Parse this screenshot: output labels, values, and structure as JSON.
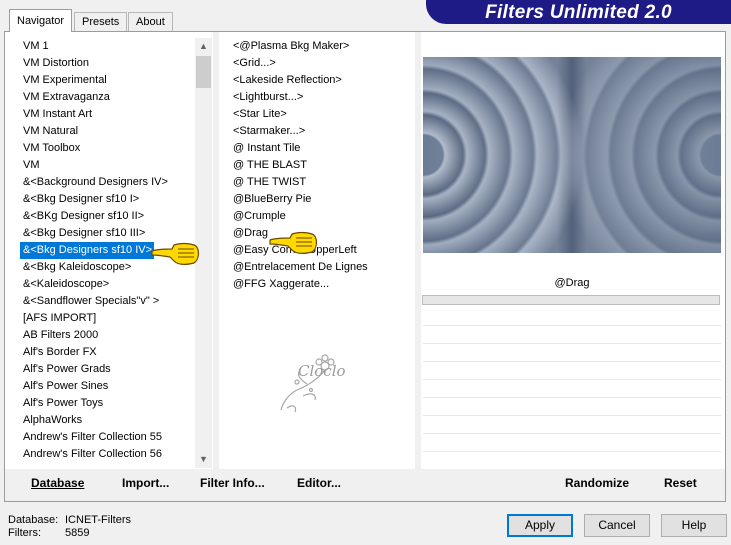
{
  "tabs": [
    "Navigator",
    "Presets",
    "About"
  ],
  "active_tab": "Navigator",
  "banner": "Filters Unlimited 2.0",
  "categories": [
    "VM 1",
    "VM Distortion",
    "VM Experimental",
    "VM Extravaganza",
    "VM Instant Art",
    "VM Natural",
    "VM Toolbox",
    "VM",
    "&<Background Designers IV>",
    "&<Bkg Designer sf10 I>",
    "&<BKg Designer sf10 II>",
    "&<Bkg Designer sf10 III>",
    "&<Bkg Designers sf10 IV>",
    "&<Bkg Kaleidoscope>",
    "&<Kaleidoscope>",
    "&<Sandflower Specials\"v\" >",
    "[AFS IMPORT]",
    "AB Filters 2000",
    "Alf's Border FX",
    "Alf's Power Grads",
    "Alf's Power Sines",
    "Alf's Power Toys",
    "AlphaWorks",
    "Andrew's Filter Collection 55",
    "Andrew's Filter Collection 56"
  ],
  "selected_category": "&<Bkg Designers sf10 IV>",
  "filters": [
    "<@Plasma Bkg Maker>",
    "<Grid...>",
    "<Lakeside Reflection>",
    "<Lightburst...>",
    "<Star Lite>",
    "<Starmaker...>",
    "@ Instant Tile",
    "@ THE BLAST",
    "@ THE TWIST",
    "@BlueBerry Pie",
    "@Crumple",
    "@Drag",
    "@Easy Corner UpperLeft",
    "@Entrelacement De Lignes",
    "@FFG Xaggerate..."
  ],
  "preview": {
    "filter_name": "@Drag",
    "watermark": "Cloclo"
  },
  "toolbar": {
    "database": "Database",
    "import": "Import...",
    "filter_info": "Filter Info...",
    "editor": "Editor...",
    "randomize": "Randomize",
    "reset": "Reset"
  },
  "info": {
    "database_label": "Database:",
    "database_value": "ICNET-Filters",
    "filters_label": "Filters:",
    "filters_value": "5859"
  },
  "buttons": {
    "apply": "Apply",
    "cancel": "Cancel",
    "help": "Help"
  },
  "colors": {
    "banner_bg": "#1e1a86",
    "selection": "#0078d7",
    "apply_border": "#0078d7",
    "hand_fill": "#ffd800"
  },
  "icons": [
    "pointing-hand-icon",
    "scroll-up-icon",
    "scroll-down-icon",
    "flower-watermark-icon"
  ]
}
